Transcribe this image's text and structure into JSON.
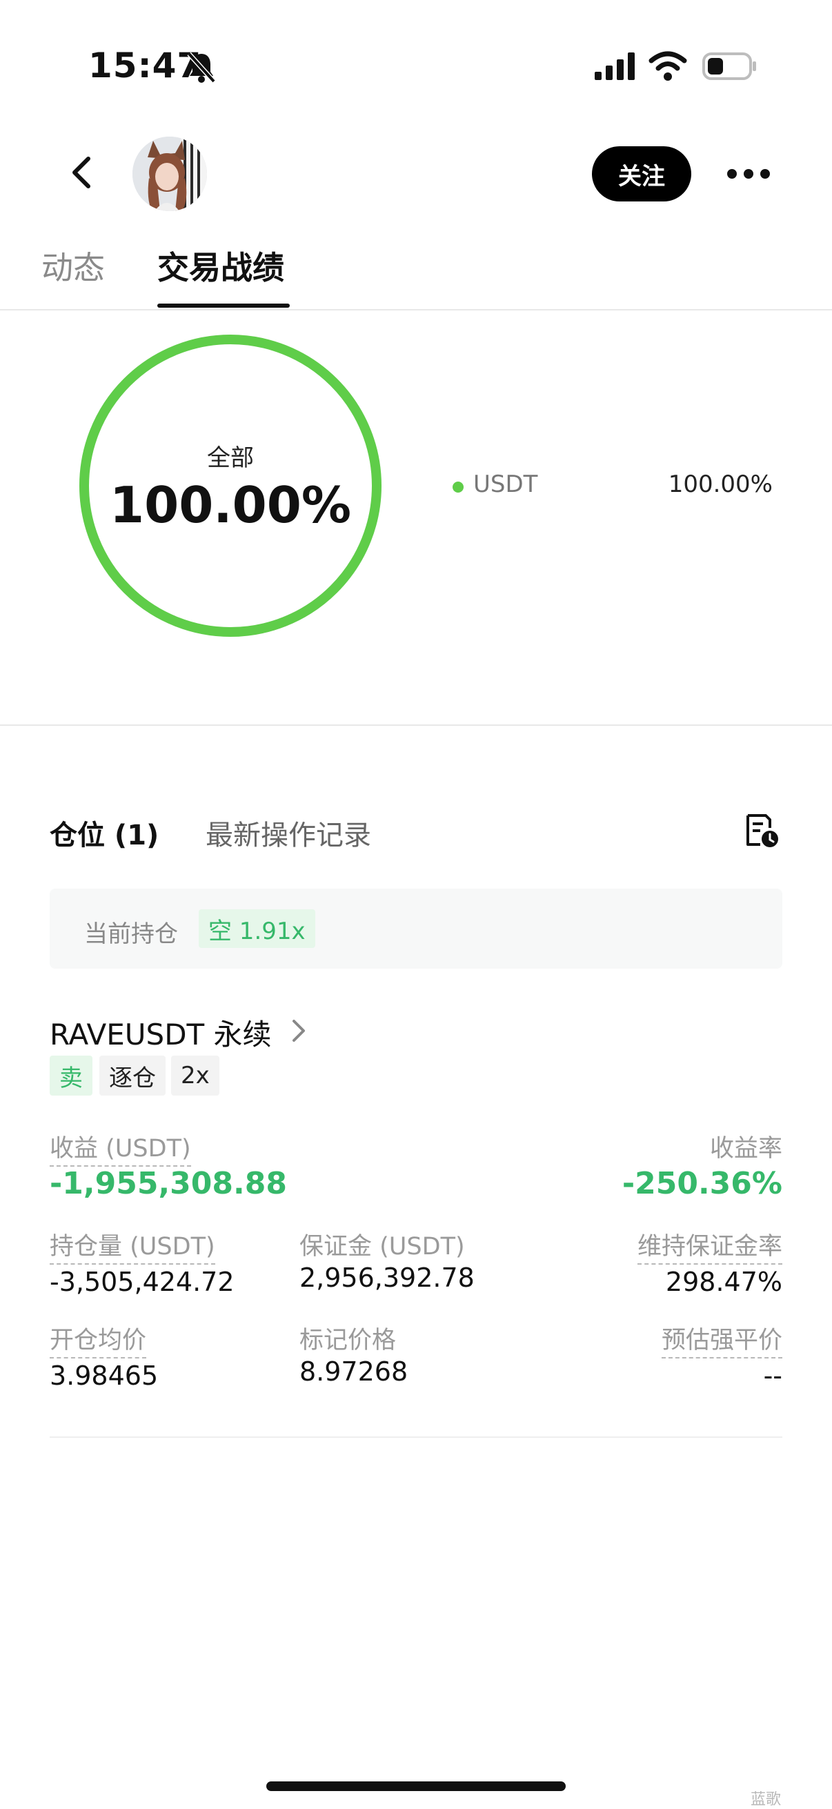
{
  "status_bar": {
    "time": "15:47"
  },
  "header": {
    "follow_label": "关注"
  },
  "tabs": [
    {
      "label": "动态",
      "active": false
    },
    {
      "label": "交易战绩",
      "active": true
    }
  ],
  "summary": {
    "ring_label": "全部",
    "ring_value": "100.00%",
    "ring_fraction": 1.0,
    "ring_color": "#5fcd49",
    "legend": [
      {
        "name": "USDT",
        "value": "100.00%"
      }
    ]
  },
  "positions": {
    "tab_active": "仓位 (1)",
    "tab_history": "最新操作记录",
    "current_label": "当前持仓",
    "current_badge": "空 1.91x"
  },
  "contract": {
    "title": "RAVEUSDT 永续",
    "tags": {
      "side": "卖",
      "mode": "逐仓",
      "leverage": "2x"
    },
    "pnl_label": "收益 (USDT)",
    "pnl_value": "-1,955,308.88",
    "roi_label": "收益率",
    "roi_value": "-250.36%",
    "size_label": "持仓量 (USDT)",
    "size_value": "-3,505,424.72",
    "margin_label": "保证金 (USDT)",
    "margin_value": "2,956,392.78",
    "mmr_label": "维持保证金率",
    "mmr_value": "298.47%",
    "entry_label": "开仓均价",
    "entry_value": "3.98465",
    "mark_label": "标记价格",
    "mark_value": "8.97268",
    "liq_label": "预估强平价",
    "liq_value": "--"
  },
  "colors": {
    "accent_green": "#36b86a",
    "ring_green": "#5fcd49"
  },
  "watermark": "蓝歌"
}
